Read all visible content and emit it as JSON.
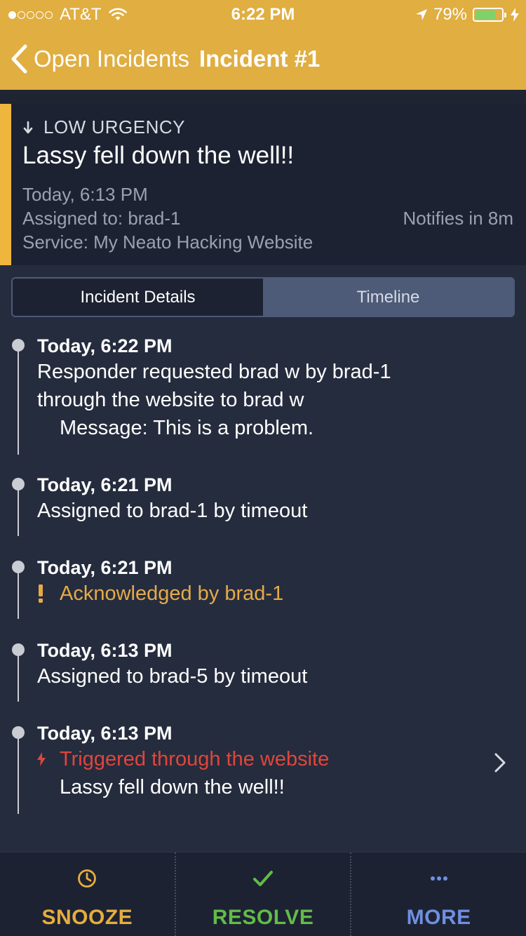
{
  "status_bar": {
    "carrier": "AT&T",
    "time": "6:22 PM",
    "battery": "79%",
    "battery_level": 0.79,
    "signal_bars": 1
  },
  "nav": {
    "back_label": "Open Incidents",
    "title": "Incident #1"
  },
  "incident": {
    "urgency": "LOW URGENCY",
    "title": "Lassy fell down the well!!",
    "time": "Today, 6:13 PM",
    "assigned": "Assigned to: brad-1",
    "service": "Service: My Neato Hacking Website",
    "notifies": "Notifies in 8m"
  },
  "tabs": {
    "details": "Incident Details",
    "timeline": "Timeline"
  },
  "timeline": [
    {
      "time": "Today, 6:22 PM",
      "line1": "Responder requested brad w by brad-1",
      "line2": "through the website to brad w",
      "message": "Message: This is a problem."
    },
    {
      "time": "Today, 6:21 PM",
      "text": "Assigned to brad-1 by timeout"
    },
    {
      "time": "Today, 6:21 PM",
      "text": "Acknowledged by brad-1"
    },
    {
      "time": "Today, 6:13 PM",
      "text": "Assigned to brad-5 by timeout"
    },
    {
      "time": "Today, 6:13 PM",
      "text": "Triggered through the website",
      "detail": "Lassy fell down the well!!"
    }
  ],
  "toolbar": {
    "snooze": "SNOOZE",
    "resolve": "RESOLVE",
    "more": "MORE"
  },
  "colors": {
    "header": "#e0ae41",
    "background": "#252c3d",
    "card": "#1d2232",
    "accent": "#efb63d",
    "acknowledged": "#e7aa48",
    "triggered": "#e0463c",
    "snooze": "#e6ad3d",
    "resolve": "#62bc48",
    "more": "#6f8fe0"
  }
}
